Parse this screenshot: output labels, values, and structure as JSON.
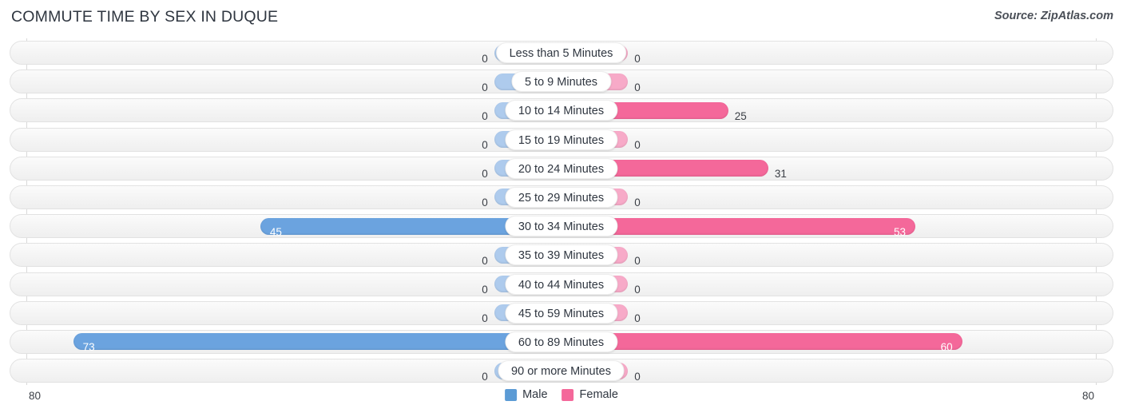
{
  "header": {
    "title": "COMMUTE TIME BY SEX IN DUQUE",
    "source": "Source: ZipAtlas.com"
  },
  "legend": {
    "male_label": "Male",
    "female_label": "Female",
    "male_color": "#5b9bd5",
    "female_color": "#f4689a"
  },
  "axis": {
    "left_tick": "80",
    "right_tick": "80",
    "max": 80
  },
  "chart_data": {
    "type": "bar",
    "title": "COMMUTE TIME BY SEX IN DUQUE",
    "subtitle": "Source: ZipAtlas.com",
    "orientation": "horizontal-diverging",
    "xlabel": "",
    "ylabel": "",
    "xlim": [
      80,
      0,
      80
    ],
    "grid": false,
    "legend_position": "bottom-center",
    "categories": [
      "Less than 5 Minutes",
      "5 to 9 Minutes",
      "10 to 14 Minutes",
      "15 to 19 Minutes",
      "20 to 24 Minutes",
      "25 to 29 Minutes",
      "30 to 34 Minutes",
      "35 to 39 Minutes",
      "40 to 44 Minutes",
      "45 to 59 Minutes",
      "60 to 89 Minutes",
      "90 or more Minutes"
    ],
    "series": [
      {
        "name": "Male",
        "color": "#5b9bd5",
        "values": [
          0,
          0,
          0,
          0,
          0,
          0,
          45,
          0,
          0,
          0,
          73,
          0
        ]
      },
      {
        "name": "Female",
        "color": "#f4689a",
        "values": [
          0,
          0,
          25,
          0,
          31,
          0,
          53,
          0,
          0,
          0,
          60,
          0
        ]
      }
    ]
  },
  "rows": [
    {
      "label": "Less than 5 Minutes",
      "male": 0,
      "male_text": "0",
      "female": 0,
      "female_text": "0"
    },
    {
      "label": "5 to 9 Minutes",
      "male": 0,
      "male_text": "0",
      "female": 0,
      "female_text": "0"
    },
    {
      "label": "10 to 14 Minutes",
      "male": 0,
      "male_text": "0",
      "female": 25,
      "female_text": "25"
    },
    {
      "label": "15 to 19 Minutes",
      "male": 0,
      "male_text": "0",
      "female": 0,
      "female_text": "0"
    },
    {
      "label": "20 to 24 Minutes",
      "male": 0,
      "male_text": "0",
      "female": 31,
      "female_text": "31"
    },
    {
      "label": "25 to 29 Minutes",
      "male": 0,
      "male_text": "0",
      "female": 0,
      "female_text": "0"
    },
    {
      "label": "30 to 34 Minutes",
      "male": 45,
      "male_text": "45",
      "female": 53,
      "female_text": "53"
    },
    {
      "label": "35 to 39 Minutes",
      "male": 0,
      "male_text": "0",
      "female": 0,
      "female_text": "0"
    },
    {
      "label": "40 to 44 Minutes",
      "male": 0,
      "male_text": "0",
      "female": 0,
      "female_text": "0"
    },
    {
      "label": "45 to 59 Minutes",
      "male": 0,
      "male_text": "0",
      "female": 0,
      "female_text": "0"
    },
    {
      "label": "60 to 89 Minutes",
      "male": 73,
      "male_text": "73",
      "female": 60,
      "female_text": "60"
    },
    {
      "label": "90 or more Minutes",
      "male": 0,
      "male_text": "0",
      "female": 0,
      "female_text": "0"
    }
  ]
}
